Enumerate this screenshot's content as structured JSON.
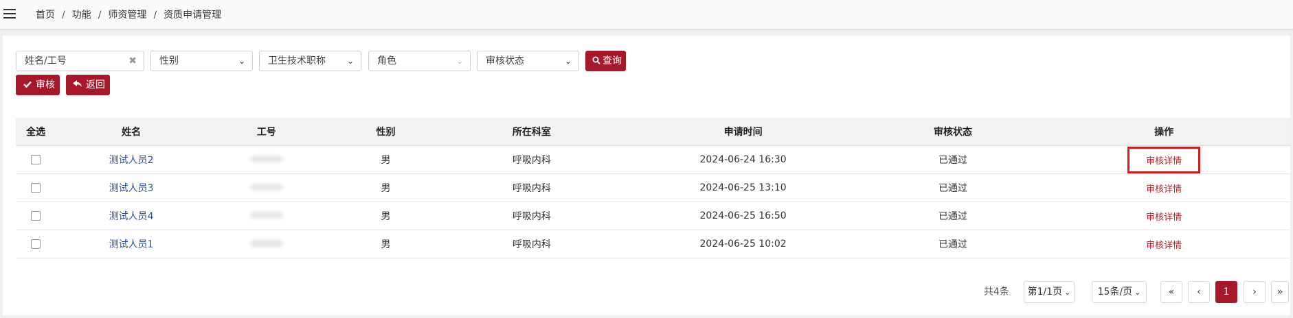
{
  "breadcrumb": [
    "首页",
    "功能",
    "师资管理",
    "资质申请管理"
  ],
  "filters": {
    "name_placeholder": "姓名/工号",
    "gender_label": "性别",
    "title_label": "卫生技术职称",
    "role_label": "角色",
    "status_label": "审核状态",
    "query_label": "查询"
  },
  "actions": {
    "review_label": "审核",
    "back_label": "返回"
  },
  "table": {
    "headers": [
      "全选",
      "姓名",
      "工号",
      "性别",
      "所在科室",
      "申请时间",
      "审核状态",
      "操作"
    ],
    "rows": [
      {
        "name": "测试人员2",
        "gender": "男",
        "dept": "呼吸内科",
        "time": "2024-06-24 16:30",
        "status": "已通过",
        "action": "审核详情"
      },
      {
        "name": "测试人员3",
        "gender": "男",
        "dept": "呼吸内科",
        "time": "2024-06-25 13:10",
        "status": "已通过",
        "action": "审核详情"
      },
      {
        "name": "测试人员4",
        "gender": "男",
        "dept": "呼吸内科",
        "time": "2024-06-25 16:50",
        "status": "已通过",
        "action": "审核详情"
      },
      {
        "name": "测试人员1",
        "gender": "男",
        "dept": "呼吸内科",
        "time": "2024-06-25 10:02",
        "status": "已通过",
        "action": "审核详情"
      }
    ]
  },
  "pagination": {
    "total": "共4条",
    "page_info": "第1/1页",
    "page_size": "15条/页",
    "current_page": "1",
    "first": "«",
    "prev": "‹",
    "next": "›",
    "last": "»"
  },
  "colors": {
    "accent": "#a8182b",
    "link": "#2a4fa3",
    "highlight": "#d51b1b"
  },
  "icons": [
    "menu-icon",
    "clear-icon",
    "chevron-down-icon",
    "search-icon",
    "check-icon",
    "reply-icon"
  ]
}
